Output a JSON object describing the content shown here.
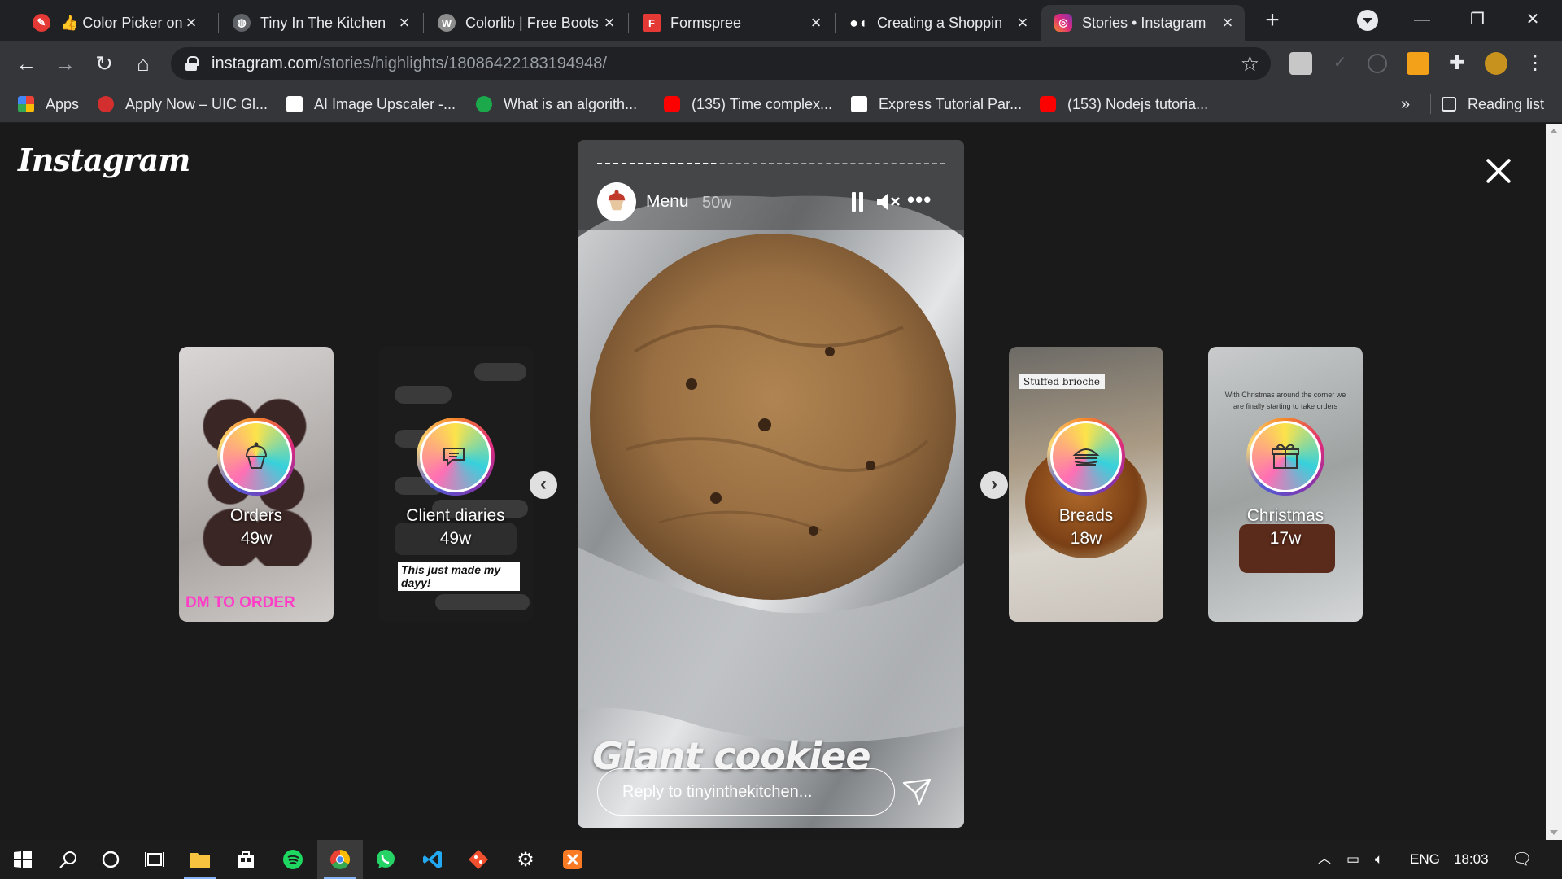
{
  "browser": {
    "tabs": [
      {
        "title": "👍 Color Picker onli",
        "icon_color": "#e53935",
        "icon": "eyedropper-icon"
      },
      {
        "title": "Tiny In The Kitchen",
        "icon_color": "#5f6368",
        "icon": "globe-icon"
      },
      {
        "title": "Colorlib | Free Boots",
        "icon_color": "#8d8d8d",
        "icon": "wordpress-icon"
      },
      {
        "title": "Formspree",
        "icon_color": "#e53935",
        "icon": "formspree-icon"
      },
      {
        "title": "Creating a Shoppin",
        "icon_color": "#ffffff",
        "icon": "medium-icon"
      },
      {
        "title": "Stories • Instagram",
        "icon_color": "#c13584",
        "icon": "instagram-icon",
        "active": true
      }
    ],
    "url_host": "instagram.com",
    "url_path": "/stories/highlights/18086422183194948/",
    "bookmarks": [
      {
        "label": "Apps",
        "icon_color": "#ea4335"
      },
      {
        "label": "Apply Now – UIC Gl...",
        "icon_color": "#d32f2f"
      },
      {
        "label": "AI Image Upscaler -...",
        "icon_color": "#ffffff"
      },
      {
        "label": "What is an algorith...",
        "icon_color": "#1ba94c"
      },
      {
        "label": "(135) Time complex...",
        "icon_color": "#ff0000"
      },
      {
        "label": "Express Tutorial Par...",
        "icon_color": "#ffffff"
      },
      {
        "label": "(153) Nodejs tutoria...",
        "icon_color": "#ff0000"
      }
    ],
    "more_bookmarks": "»",
    "reading_list": "Reading list"
  },
  "instagram": {
    "logo": "Instagram",
    "highlights": [
      {
        "name": "Orders",
        "age": "49w",
        "overlay": "DM TO ORDER",
        "icon": "cupcake-icon",
        "bg": "#b8b4b2"
      },
      {
        "name": "Client diaries",
        "age": "49w",
        "overlay": "This just made my dayy!",
        "icon": "chat-icon",
        "bg": "#1f1f1f"
      },
      {
        "name": "Breads",
        "age": "18w",
        "overlay": "Stuffed brioche",
        "icon": "sandwich-icon",
        "bg": "#9b8a74"
      },
      {
        "name": "Christmas",
        "age": "17w",
        "overlay": "With Christmas around the corner we are finally starting to take orders",
        "icon": "gift-icon",
        "bg": "#b9bcbd"
      }
    ],
    "story": {
      "username": "Menu",
      "age": "50w",
      "caption": "Giant cookiee",
      "reply_placeholder": "Reply to tinyinthekitchen...",
      "progress": 0.34
    }
  },
  "taskbar": {
    "language": "ENG",
    "time": "18:03"
  }
}
